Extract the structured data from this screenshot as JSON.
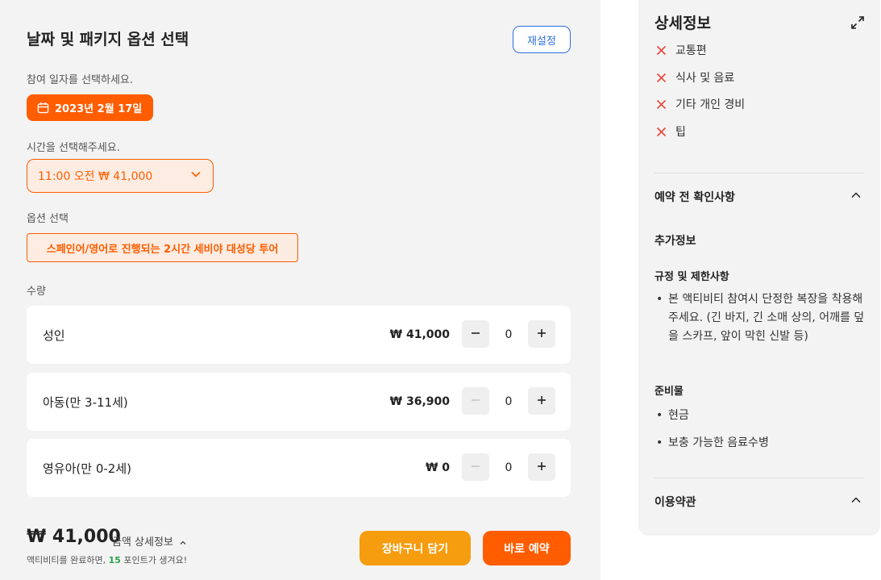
{
  "booking": {
    "title": "날짜 및 패키지 옵션 선택",
    "reset_label": "재설정",
    "date_prompt": "참여 일자를 선택하세요.",
    "selected_date": "2023년 2월 17일",
    "time_prompt": "시간을 선택해주세요.",
    "selected_time": "11:00 오전 ₩ 41,000",
    "option_prompt": "옵션 선택",
    "selected_option": "스페인어/영어로 진행되는 2시간 세비야 대성당 투어",
    "quantity_label": "수량",
    "rows": [
      {
        "name": "성인",
        "price": "₩ 41,000",
        "count": "0",
        "minus_enabled": true
      },
      {
        "name": "아동(만 3-11세)",
        "price": "₩ 36,900",
        "count": "0",
        "minus_enabled": false
      },
      {
        "name": "영유아(만 0-2세)",
        "price": "₩ 0",
        "count": "0",
        "minus_enabled": false
      }
    ],
    "total": "₩ 41,000",
    "total_detail": "금액 상세정보",
    "points_before": "액티비티를 완료하면, ",
    "points_value": "15",
    "points_after": " 포인트가 생겨요!",
    "cart_label": "장바구니 담기",
    "book_label": "바로 예약"
  },
  "details": {
    "title": "상세정보",
    "excluded": [
      "교통편",
      "식사 및 음료",
      "기타 개인 경비",
      "팁"
    ],
    "pre_check_title": "예약 전 확인사항",
    "additional_info": "추가정보",
    "rules_title": "규정 및 제한사항",
    "rules": [
      "본 액티비티 참여시 단정한 복장을 착용해주세요. (긴 바지, 긴 소매 상의, 어깨를 덮을 스카프, 앞이 막힌 신발 등)"
    ],
    "prep_title": "준비물",
    "prep_items": [
      "현금",
      "보충 가능한 음료수병"
    ],
    "terms_title": "이용약관"
  },
  "colors": {
    "accent": "#ff5d00",
    "cart": "#f59c0f",
    "link_blue": "#2d6fdc",
    "exclude_red": "#e8463a",
    "points_green": "#2aa14a"
  }
}
